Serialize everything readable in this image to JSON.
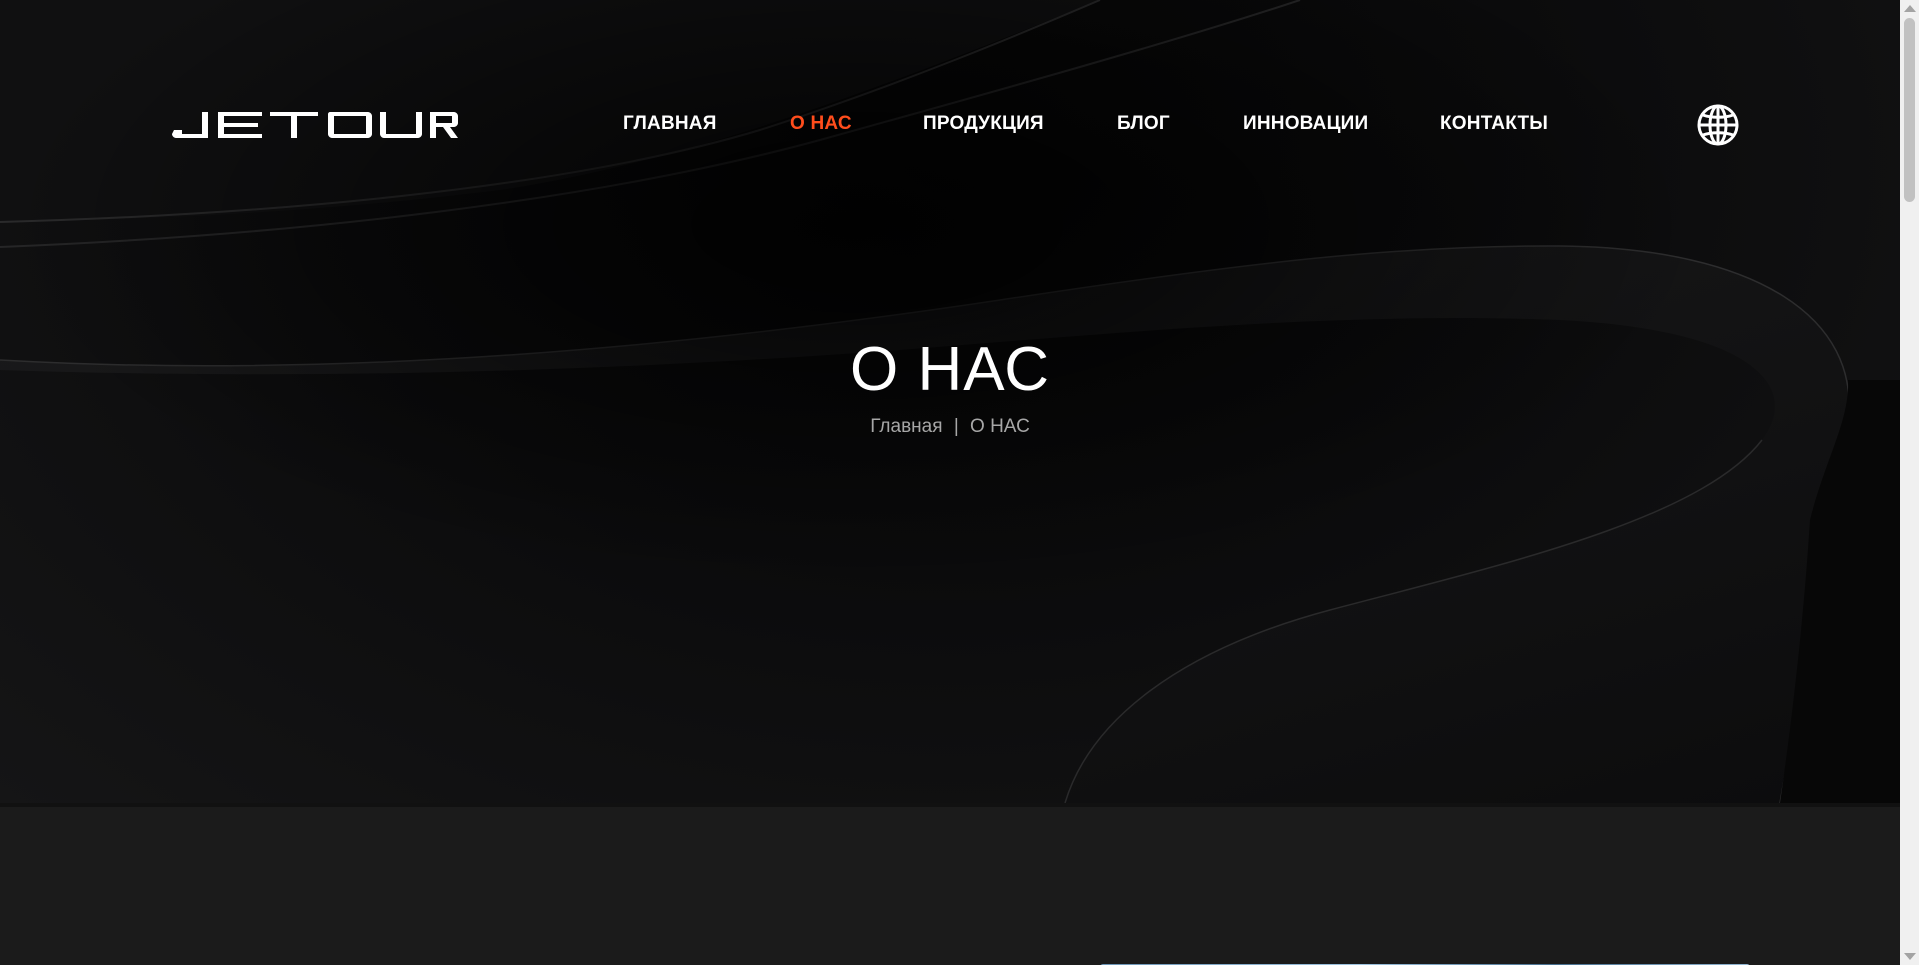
{
  "header": {
    "logo_text": "JETOUR",
    "nav": [
      {
        "label": "ГЛАВНАЯ",
        "active": false
      },
      {
        "label": "О НАС",
        "active": true
      },
      {
        "label": "ПРОДУКЦИЯ",
        "active": false
      },
      {
        "label": "БЛОГ",
        "active": false
      },
      {
        "label": "ИННОВАЦИИ",
        "active": false
      },
      {
        "label": "КОНТАКТЫ",
        "active": false
      }
    ],
    "language_icon": "globe-icon"
  },
  "hero": {
    "title": "О НАС",
    "breadcrumb": {
      "home": "Главная",
      "separator": "|",
      "current": "О НАС"
    }
  },
  "colors": {
    "accent": "#ff4d1c",
    "nav_text": "#ffffff",
    "breadcrumb_text": "#a7a7a7",
    "hero_background": "#0b0b0c",
    "section_background": "#1b1b1b"
  }
}
